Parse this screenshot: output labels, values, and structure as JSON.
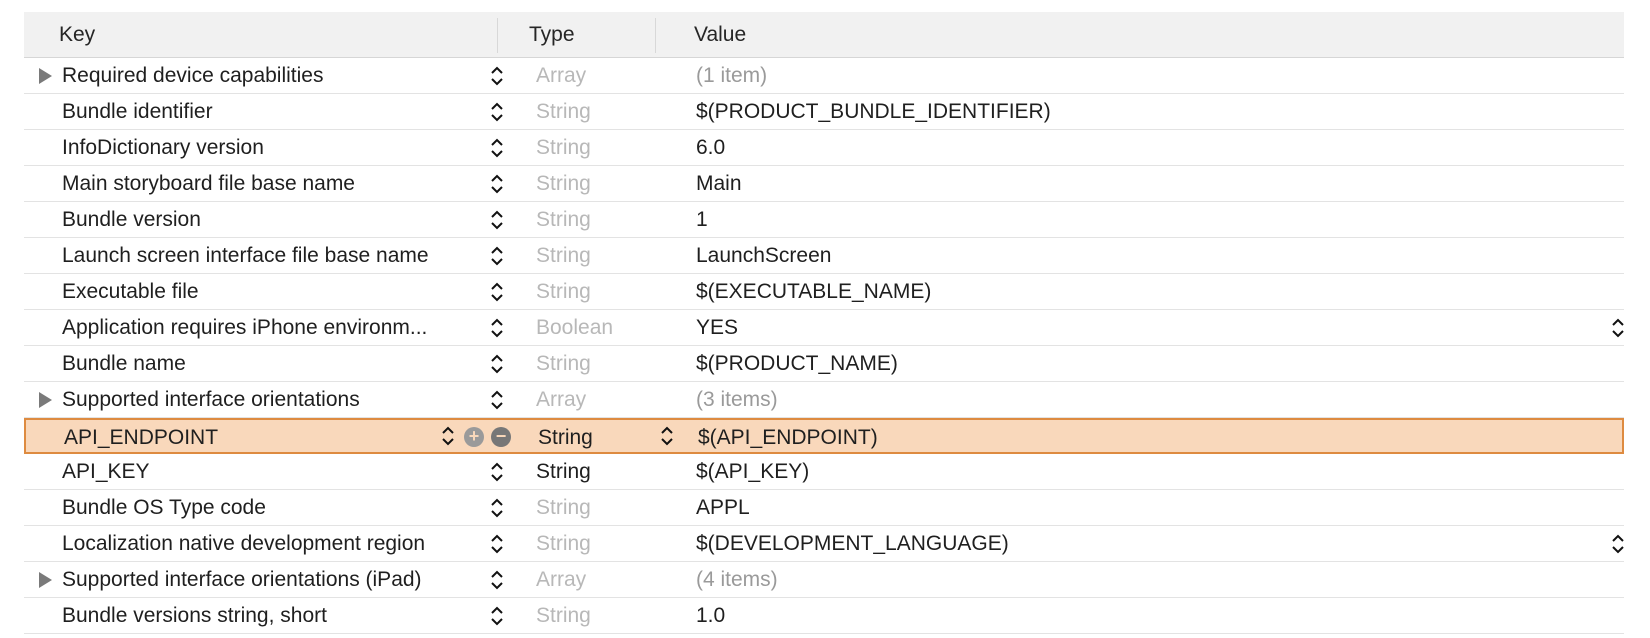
{
  "columns": {
    "key": "Key",
    "type": "Type",
    "value": "Value"
  },
  "rows": [
    {
      "key": "Required device capabilities",
      "type": "Array",
      "value": "(1 item)"
    },
    {
      "key": "Bundle identifier",
      "type": "String",
      "value": "$(PRODUCT_BUNDLE_IDENTIFIER)"
    },
    {
      "key": "InfoDictionary version",
      "type": "String",
      "value": "6.0"
    },
    {
      "key": "Main storyboard file base name",
      "type": "String",
      "value": "Main"
    },
    {
      "key": "Bundle version",
      "type": "String",
      "value": "1"
    },
    {
      "key": "Launch screen interface file base name",
      "type": "String",
      "value": "LaunchScreen"
    },
    {
      "key": "Executable file",
      "type": "String",
      "value": "$(EXECUTABLE_NAME)"
    },
    {
      "key": "Application requires iPhone environm...",
      "type": "Boolean",
      "value": "YES"
    },
    {
      "key": "Bundle name",
      "type": "String",
      "value": "$(PRODUCT_NAME)"
    },
    {
      "key": "Supported interface orientations",
      "type": "Array",
      "value": "(3 items)"
    },
    {
      "key": "API_ENDPOINT",
      "type": "String",
      "value": "$(API_ENDPOINT)"
    },
    {
      "key": "API_KEY",
      "type": "String",
      "value": "$(API_KEY)"
    },
    {
      "key": "Bundle OS Type code",
      "type": "String",
      "value": "APPL"
    },
    {
      "key": "Localization native development region",
      "type": "String",
      "value": "$(DEVELOPMENT_LANGUAGE)"
    },
    {
      "key": "Supported interface orientations (iPad)",
      "type": "Array",
      "value": "(4 items)"
    },
    {
      "key": "Bundle versions string, short",
      "type": "String",
      "value": "1.0"
    }
  ],
  "actions": {
    "add_symbol": "+",
    "remove_symbol": "−"
  },
  "colors": {
    "selection_fill": "#f9d8bb",
    "selection_border": "#de8b40",
    "muted_text": "#b8b8b8"
  }
}
